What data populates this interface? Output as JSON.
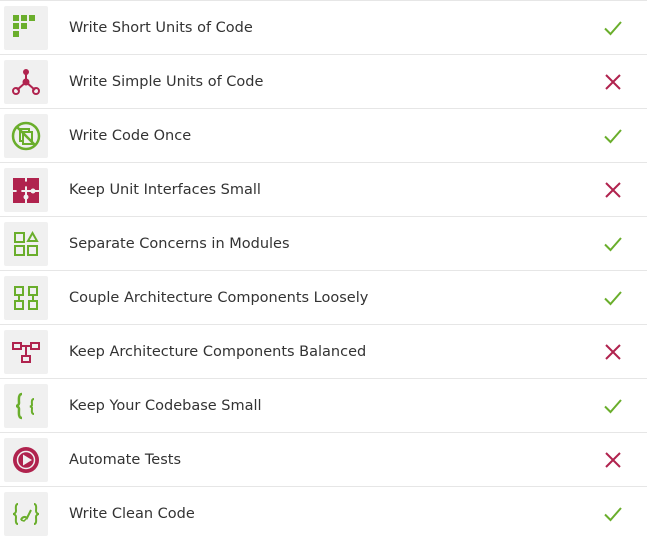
{
  "colors": {
    "pass": "#6aae2c",
    "fail": "#b0234e",
    "icon_green": "#6aae2c",
    "icon_red": "#b0234e"
  },
  "items": [
    {
      "label": "Write Short Units of Code",
      "icon": "short-units-icon",
      "status": "pass"
    },
    {
      "label": "Write Simple Units of Code",
      "icon": "simple-units-icon",
      "status": "fail"
    },
    {
      "label": "Write Code Once",
      "icon": "code-once-icon",
      "status": "pass"
    },
    {
      "label": "Keep Unit Interfaces Small",
      "icon": "unit-interfaces-icon",
      "status": "fail"
    },
    {
      "label": "Separate Concerns in Modules",
      "icon": "separate-concerns-icon",
      "status": "pass"
    },
    {
      "label": "Couple Architecture Components Loosely",
      "icon": "couple-components-icon",
      "status": "pass"
    },
    {
      "label": "Keep Architecture Components Balanced",
      "icon": "balanced-components-icon",
      "status": "fail"
    },
    {
      "label": "Keep Your Codebase Small",
      "icon": "codebase-small-icon",
      "status": "pass"
    },
    {
      "label": "Automate Tests",
      "icon": "automate-tests-icon",
      "status": "fail"
    },
    {
      "label": "Write Clean Code",
      "icon": "clean-code-icon",
      "status": "pass"
    }
  ]
}
